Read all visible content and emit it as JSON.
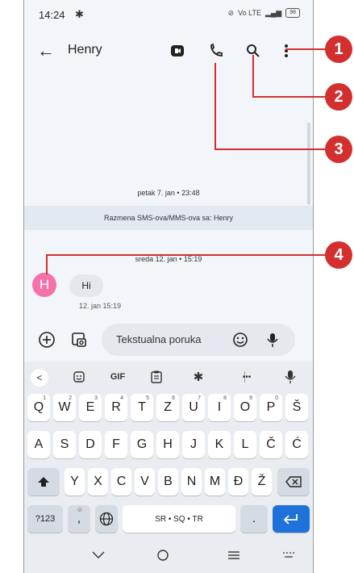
{
  "status_bar": {
    "time": "14:24",
    "network": "Vo LTE",
    "battery": "98"
  },
  "header": {
    "title": "Henry"
  },
  "conversation": {
    "timestamp_1": "petak 7. jan • 23:48",
    "banner": "Razmena SMS-ova/MMS-ova sa: Henry",
    "timestamp_2": "sreda 12. jan • 15:19",
    "avatar_letter": "H",
    "message_text": "Hi",
    "message_time": "12. jan 15:19"
  },
  "composer": {
    "placeholder": "Tekstualna poruka"
  },
  "keyboard": {
    "suggestions": {
      "back": "<",
      "gif": "GIF",
      "more": "•••"
    },
    "row1": [
      {
        "key": "Q",
        "hint": "1"
      },
      {
        "key": "W",
        "hint": "2"
      },
      {
        "key": "E",
        "hint": "3"
      },
      {
        "key": "R",
        "hint": "4"
      },
      {
        "key": "T",
        "hint": "5"
      },
      {
        "key": "Z",
        "hint": "6"
      },
      {
        "key": "U",
        "hint": "7"
      },
      {
        "key": "I",
        "hint": "8"
      },
      {
        "key": "O",
        "hint": "9"
      },
      {
        "key": "P",
        "hint": "0"
      },
      {
        "key": "Š",
        "hint": ""
      }
    ],
    "row2": [
      "A",
      "S",
      "D",
      "F",
      "G",
      "H",
      "J",
      "K",
      "L",
      "Č",
      "Ć"
    ],
    "row3": [
      "Y",
      "X",
      "C",
      "V",
      "B",
      "N",
      "M",
      "Đ",
      "Ž"
    ],
    "row4": {
      "symbols": "?123",
      "comma": ",",
      "space": "SR • SQ • TR",
      "period": "."
    }
  },
  "callouts": [
    "1",
    "2",
    "3",
    "4"
  ],
  "colors": {
    "accent": "#1f72d9",
    "avatar": "#f472a9",
    "callout": "#d32f2f"
  }
}
